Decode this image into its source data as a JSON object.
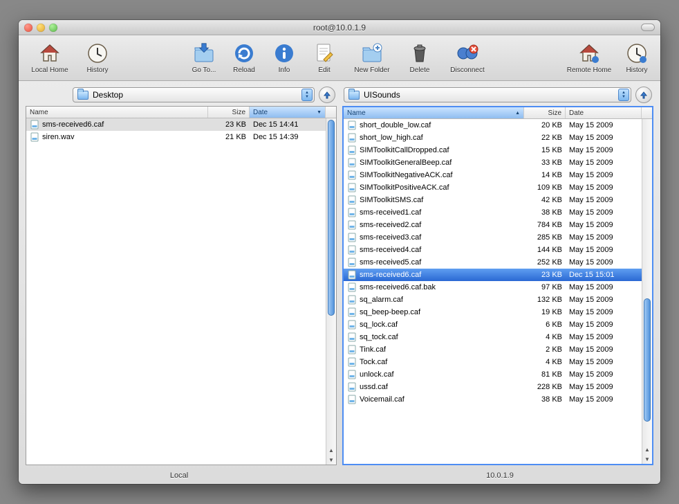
{
  "title": "root@10.0.1.9",
  "toolbar": {
    "local_home": "Local Home",
    "history_l": "History",
    "goto": "Go To...",
    "reload": "Reload",
    "info": "Info",
    "edit": "Edit",
    "new_folder": "New Folder",
    "delete": "Delete",
    "disconnect": "Disconnect",
    "remote_home": "Remote Home",
    "history_r": "History"
  },
  "columns": {
    "name": "Name",
    "size": "Size",
    "date": "Date"
  },
  "local": {
    "path": "Desktop",
    "footer": "Local",
    "sort": "date",
    "files": [
      {
        "name": "sms-received6.caf",
        "size": "23 KB",
        "date": "Dec 15 14:41",
        "sel": true
      },
      {
        "name": "siren.wav",
        "size": "21 KB",
        "date": "Dec 15 14:39"
      }
    ]
  },
  "remote": {
    "path": "UISounds",
    "footer": "10.0.1.9",
    "sort": "name",
    "files": [
      {
        "name": "short_double_low.caf",
        "size": "20 KB",
        "date": "May 15 2009"
      },
      {
        "name": "short_low_high.caf",
        "size": "22 KB",
        "date": "May 15 2009"
      },
      {
        "name": "SIMToolkitCallDropped.caf",
        "size": "15 KB",
        "date": "May 15 2009"
      },
      {
        "name": "SIMToolkitGeneralBeep.caf",
        "size": "33 KB",
        "date": "May 15 2009"
      },
      {
        "name": "SIMToolkitNegativeACK.caf",
        "size": "14 KB",
        "date": "May 15 2009"
      },
      {
        "name": "SIMToolkitPositiveACK.caf",
        "size": "109 KB",
        "date": "May 15 2009"
      },
      {
        "name": "SIMToolkitSMS.caf",
        "size": "42 KB",
        "date": "May 15 2009"
      },
      {
        "name": "sms-received1.caf",
        "size": "38 KB",
        "date": "May 15 2009"
      },
      {
        "name": "sms-received2.caf",
        "size": "784 KB",
        "date": "May 15 2009"
      },
      {
        "name": "sms-received3.caf",
        "size": "285 KB",
        "date": "May 15 2009"
      },
      {
        "name": "sms-received4.caf",
        "size": "144 KB",
        "date": "May 15 2009"
      },
      {
        "name": "sms-received5.caf",
        "size": "252 KB",
        "date": "May 15 2009"
      },
      {
        "name": "sms-received6.caf",
        "size": "23 KB",
        "date": "Dec 15 15:01",
        "sel": true
      },
      {
        "name": "sms-received6.caf.bak",
        "size": "97 KB",
        "date": "May 15 2009"
      },
      {
        "name": "sq_alarm.caf",
        "size": "132 KB",
        "date": "May 15 2009"
      },
      {
        "name": "sq_beep-beep.caf",
        "size": "19 KB",
        "date": "May 15 2009"
      },
      {
        "name": "sq_lock.caf",
        "size": "6 KB",
        "date": "May 15 2009"
      },
      {
        "name": "sq_tock.caf",
        "size": "4 KB",
        "date": "May 15 2009"
      },
      {
        "name": "Tink.caf",
        "size": "2 KB",
        "date": "May 15 2009"
      },
      {
        "name": "Tock.caf",
        "size": "4 KB",
        "date": "May 15 2009"
      },
      {
        "name": "unlock.caf",
        "size": "81 KB",
        "date": "May 15 2009"
      },
      {
        "name": "ussd.caf",
        "size": "228 KB",
        "date": "May 15 2009"
      },
      {
        "name": "Voicemail.caf",
        "size": "38 KB",
        "date": "May 15 2009"
      }
    ]
  }
}
